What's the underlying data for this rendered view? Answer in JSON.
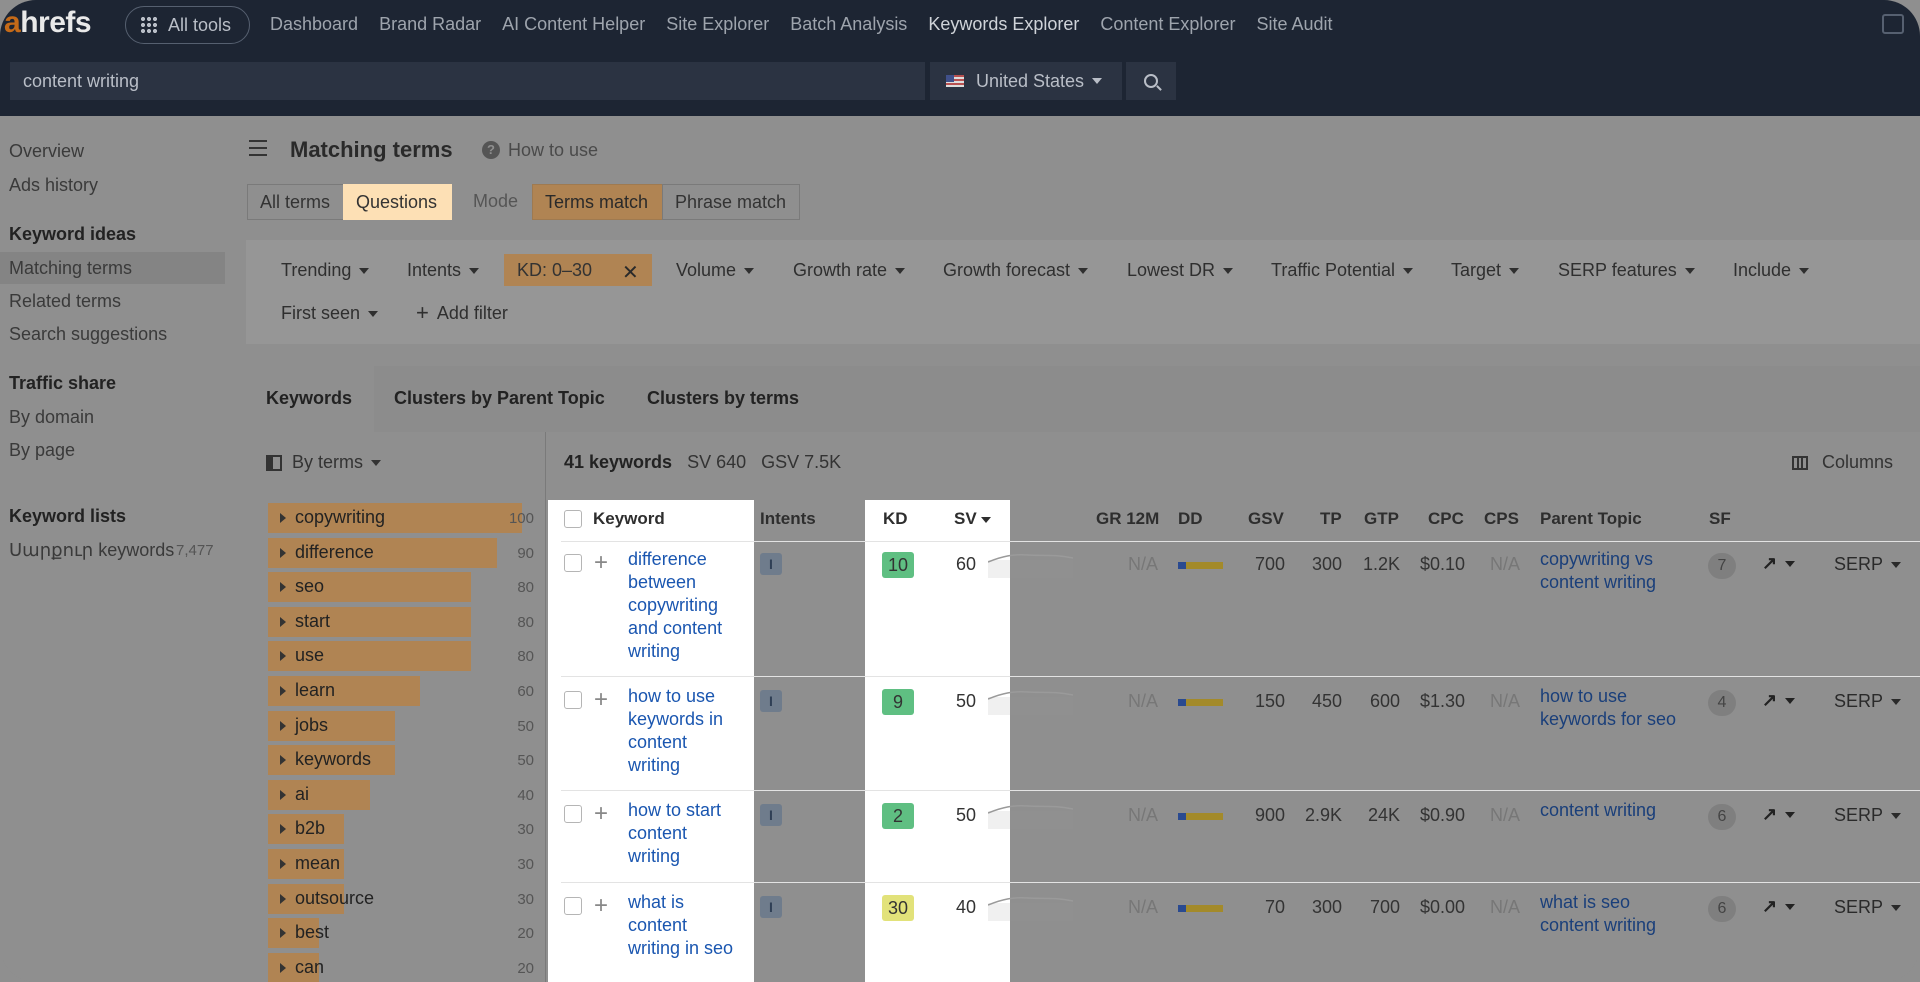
{
  "app": {
    "logo_prefix": "a",
    "logo_rest": "hrefs",
    "all_tools": "All tools",
    "nav": [
      "Dashboard",
      "Brand Radar",
      "AI Content Helper",
      "Site Explorer",
      "Batch Analysis",
      "Keywords Explorer",
      "Content Explorer",
      "Site Audit"
    ],
    "search_value": "content writing",
    "country": "United States"
  },
  "sidebar": {
    "overview": "Overview",
    "ads_history": "Ads history",
    "keyword_ideas": "Keyword ideas",
    "matching_terms": "Matching terms",
    "related_terms": "Related terms",
    "search_suggestions": "Search suggestions",
    "traffic_share": "Traffic share",
    "by_domain": "By domain",
    "by_page": "By page",
    "keyword_lists": "Keyword lists",
    "list_name": "Սարքուր keywords",
    "list_count": "7,477"
  },
  "header": {
    "title": "Matching terms",
    "help": "How to use",
    "help_icon": "?",
    "seg_all": "All terms",
    "seg_questions": "Questions",
    "mode": "Mode",
    "seg_terms": "Terms match",
    "seg_phrase": "Phrase match"
  },
  "filters": {
    "trending": "Trending",
    "intents": "Intents",
    "kd": "KD: 0–30",
    "kd_clear": "✕",
    "volume": "Volume",
    "growth_rate": "Growth rate",
    "growth_forecast": "Growth forecast",
    "lowest_dr": "Lowest DR",
    "traffic_potential": "Traffic Potential",
    "target": "Target",
    "serp_features": "SERP features",
    "include": "Include",
    "first_seen": "First seen",
    "add_filter": "Add filter"
  },
  "tabs": [
    "Keywords",
    "Clusters by Parent Topic",
    "Clusters by terms"
  ],
  "terms_panel": {
    "title": "By terms",
    "items": [
      {
        "label": "copywriting",
        "count": "100"
      },
      {
        "label": "difference",
        "count": "90"
      },
      {
        "label": "seo",
        "count": "80"
      },
      {
        "label": "start",
        "count": "80"
      },
      {
        "label": "use",
        "count": "80"
      },
      {
        "label": "learn",
        "count": "60"
      },
      {
        "label": "jobs",
        "count": "50"
      },
      {
        "label": "keywords",
        "count": "50"
      },
      {
        "label": "ai",
        "count": "40"
      },
      {
        "label": "b2b",
        "count": "30"
      },
      {
        "label": "mean",
        "count": "30"
      },
      {
        "label": "outsource",
        "count": "30"
      },
      {
        "label": "best",
        "count": "20"
      },
      {
        "label": "can",
        "count": "20"
      }
    ]
  },
  "stats": {
    "keywords": "41 keywords",
    "sv": "SV 640",
    "gsv": "GSV 7.5K"
  },
  "columns_label": "Columns",
  "table": {
    "headers": {
      "keyword": "Keyword",
      "intents": "Intents",
      "kd": "KD",
      "sv": "SV",
      "gr": "GR 12M",
      "dd": "DD",
      "gsv": "GSV",
      "tp": "TP",
      "gtp": "GTP",
      "cpc": "CPC",
      "cps": "CPS",
      "parent": "Parent Topic",
      "sf": "SF"
    },
    "rows": [
      {
        "keyword": "difference between copywriting and content writing",
        "intent": "I",
        "kd": "10",
        "kd_color": "#5fbf82",
        "sv": "60",
        "gr": "N/A",
        "gsv": "700",
        "tp": "300",
        "gtp": "1.2K",
        "cpc": "$0.10",
        "cps": "N/A",
        "parent": "copywriting vs content writing",
        "sf": "7",
        "serp": "SERP"
      },
      {
        "keyword": "how to use keywords in content writing",
        "intent": "I",
        "kd": "9",
        "kd_color": "#5fbf82",
        "sv": "50",
        "gr": "N/A",
        "gsv": "150",
        "tp": "450",
        "gtp": "600",
        "cpc": "$1.30",
        "cps": "N/A",
        "parent": "how to use keywords for seo",
        "sf": "4",
        "serp": "SERP"
      },
      {
        "keyword": "how to start content writing",
        "intent": "I",
        "kd": "2",
        "kd_color": "#5fbf82",
        "sv": "50",
        "gr": "N/A",
        "gsv": "900",
        "tp": "2.9K",
        "gtp": "24K",
        "cpc": "$0.90",
        "cps": "N/A",
        "parent": "content writing",
        "sf": "6",
        "serp": "SERP"
      },
      {
        "keyword": "what is content writing in seo",
        "intent": "I",
        "kd": "30",
        "kd_color": "#e2e27a",
        "sv": "40",
        "gr": "N/A",
        "gsv": "70",
        "tp": "300",
        "gtp": "700",
        "cpc": "$0.00",
        "cps": "N/A",
        "parent": "what is seo content writing",
        "sf": "6",
        "serp": "SERP"
      }
    ]
  },
  "colors": {
    "accent_orange": "#fde0b5",
    "chip_orange": "#b08453",
    "link_blue": "#1a56b0",
    "nav_bg": "#1d2533"
  }
}
